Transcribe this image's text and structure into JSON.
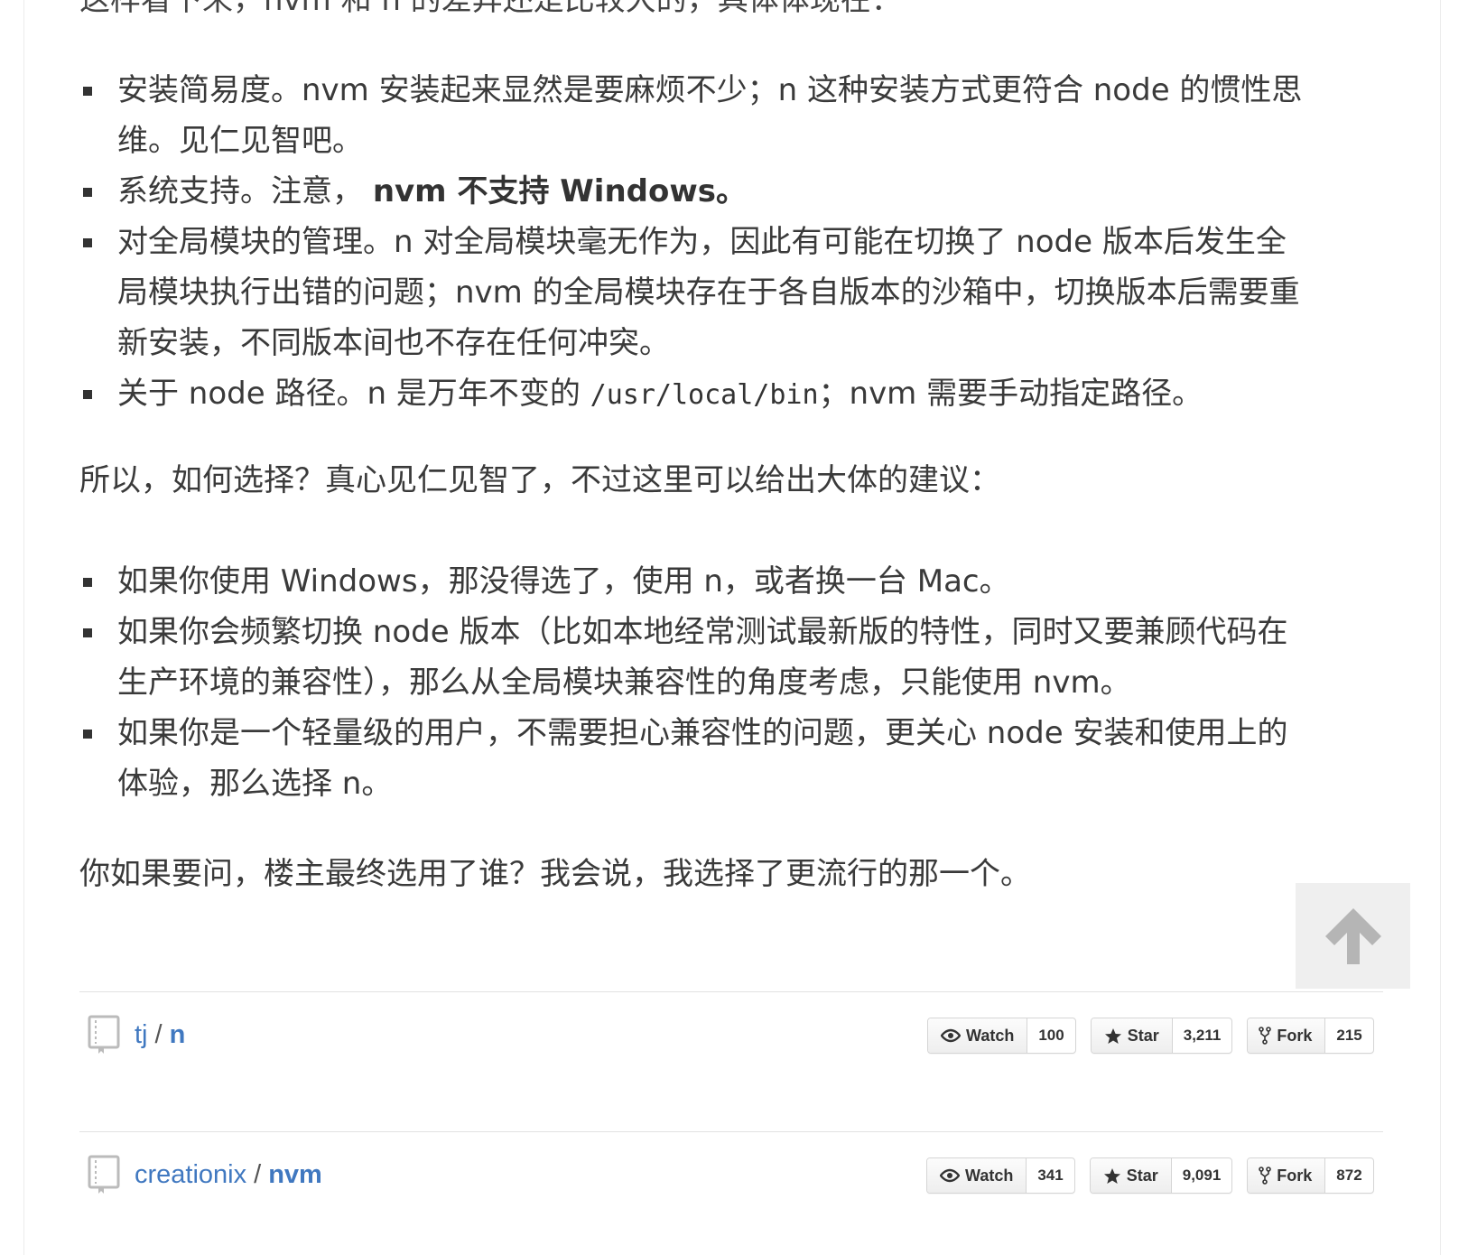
{
  "intro_cut": "这样看下来，nvm 和 n 的差异还是比较大的，具体体现在：",
  "comparison": [
    {
      "text": "安装简易度。nvm 安装起来显然是要麻烦不少；n 这种安装方式更符合 node 的惯性思",
      "cont": "维。见仁见智吧。"
    },
    {
      "prefix": "系统支持。注意，",
      "bold": "nvm 不支持 Windows。"
    },
    {
      "text": "对全局模块的管理。n 对全局模块毫无作为，因此有可能在切换了 node 版本后发生全",
      "cont": "局模块执行出错的问题；nvm 的全局模块存在于各自版本的沙箱中，切换版本后需要重",
      "cont2": "新安装，不同版本间也不存在任何冲突。"
    },
    {
      "prefix": "关于 node 路径。n 是万年不变的 ",
      "code": "/usr/local/bin",
      "suffix": "；nvm 需要手动指定路径。"
    }
  ],
  "advice_intro": "所以，如何选择？真心见仁见智了，不过这里可以给出大体的建议：",
  "advice": [
    {
      "text": "如果你使用 Windows，那没得选了，使用 n，或者换一台 Mac。"
    },
    {
      "text": "如果你会频繁切换 node 版本（比如本地经常测试最新版的特性，同时又要兼顾代码在",
      "cont": "生产环境的兼容性），那么从全局模块兼容性的角度考虑，只能使用 nvm。"
    },
    {
      "text": "如果你是一个轻量级的用户，不需要担心兼容性的问题，更关心 node 安装和使用上的",
      "cont": "体验，那么选择 n。"
    }
  ],
  "closing": "你如果要问，楼主最终选用了谁？我会说，我选择了更流行的那一个。",
  "repos": [
    {
      "owner": "tj",
      "name": "n",
      "watch_label": "Watch",
      "watch": "100",
      "star_label": "Star",
      "star": "3,211",
      "fork_label": "Fork",
      "fork": "215"
    },
    {
      "owner": "creationix",
      "name": "nvm",
      "watch_label": "Watch",
      "watch": "341",
      "star_label": "Star",
      "star": "9,091",
      "fork_label": "Fork",
      "fork": "872"
    }
  ],
  "icons": {
    "back_to_top": "arrow-up-icon",
    "repo": "repo-book-icon",
    "watch": "eye-icon",
    "star": "star-icon",
    "fork": "fork-icon"
  },
  "colors": {
    "link": "#4078c0",
    "text": "#333333",
    "backtop_bg": "#efefef"
  }
}
